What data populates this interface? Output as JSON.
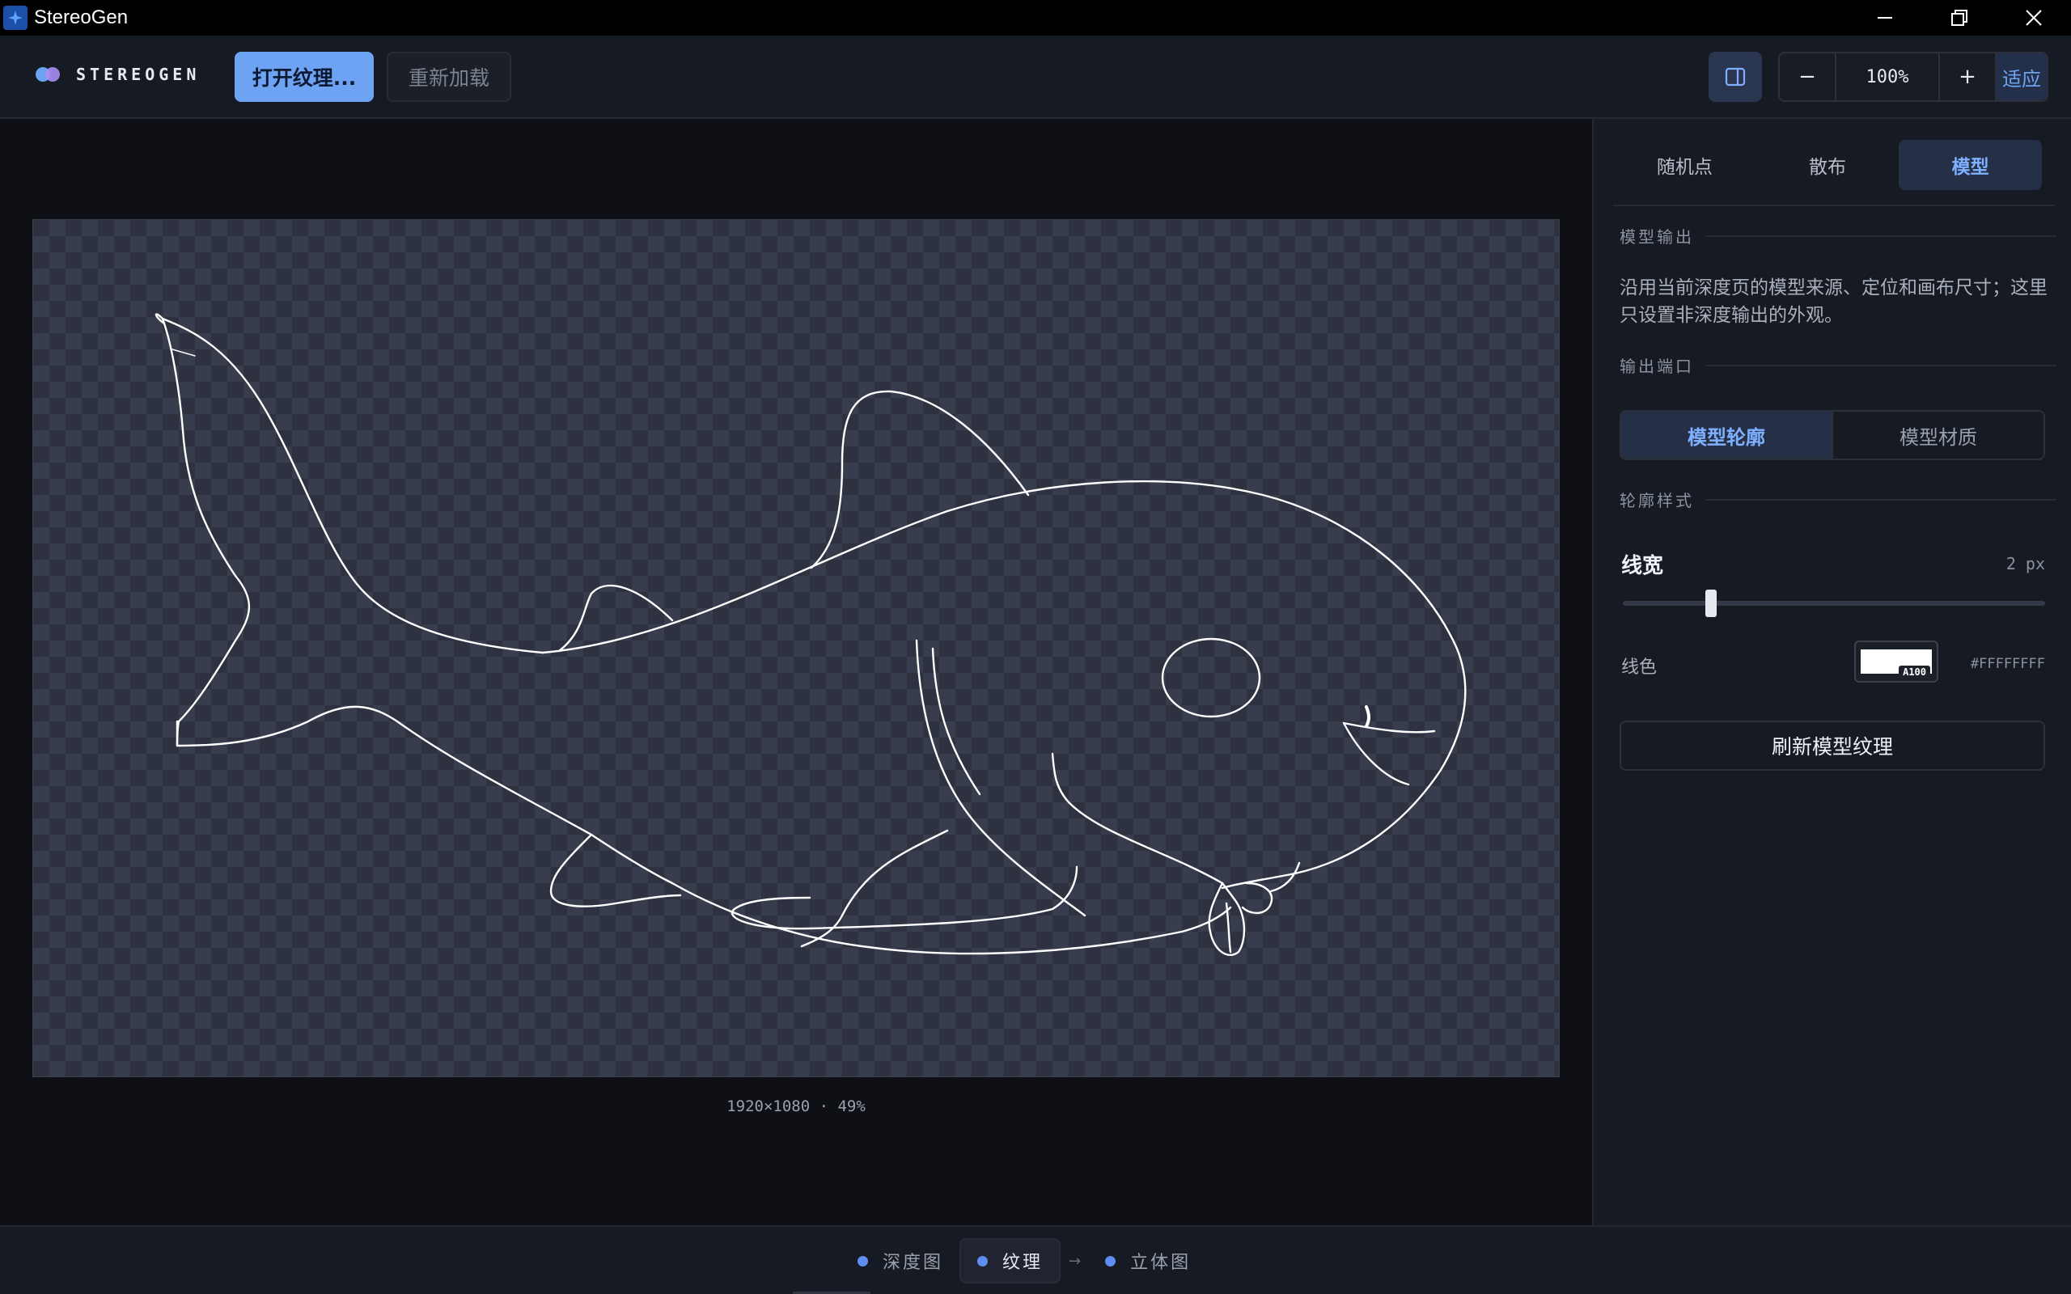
{
  "window": {
    "title": "StereoGen"
  },
  "toolbar": {
    "brand": "STEREOGEN",
    "open_label": "打开纹理...",
    "reload_label": "重新加载",
    "zoom_out": "−",
    "zoom_value": "100%",
    "zoom_in": "+",
    "fit_label": "适应"
  },
  "canvas": {
    "dimensions": "1920×1080 · 49%"
  },
  "panel": {
    "tabs": [
      {
        "label": "随机点",
        "active": false
      },
      {
        "label": "散布",
        "active": false
      },
      {
        "label": "模型",
        "active": true
      }
    ],
    "model_output_label": "模型输出",
    "description": "沿用当前深度页的模型来源、定位和画布尺寸；这里只设置非深度输出的外观。",
    "output_port_label": "输出端口",
    "output_port_options": [
      {
        "label": "模型轮廓",
        "active": true
      },
      {
        "label": "模型材质",
        "active": false
      }
    ],
    "outline_style_label": "轮廓样式",
    "line_width": {
      "label": "线宽",
      "value": "2 px",
      "level": 0.2
    },
    "line_color": {
      "label": "线色",
      "alpha": "A100",
      "hex": "#FFFFFFFF",
      "color": "#FFFFFF"
    },
    "refresh_label": "刷新模型纹理"
  },
  "steps": [
    {
      "label": "深度图",
      "active": false
    },
    {
      "label": "纹理",
      "active": true
    },
    {
      "label": "立体图",
      "active": false
    }
  ],
  "colors": {
    "accent": "#6EA3F3",
    "panel": "#161A22",
    "stage": "#0E1015"
  }
}
